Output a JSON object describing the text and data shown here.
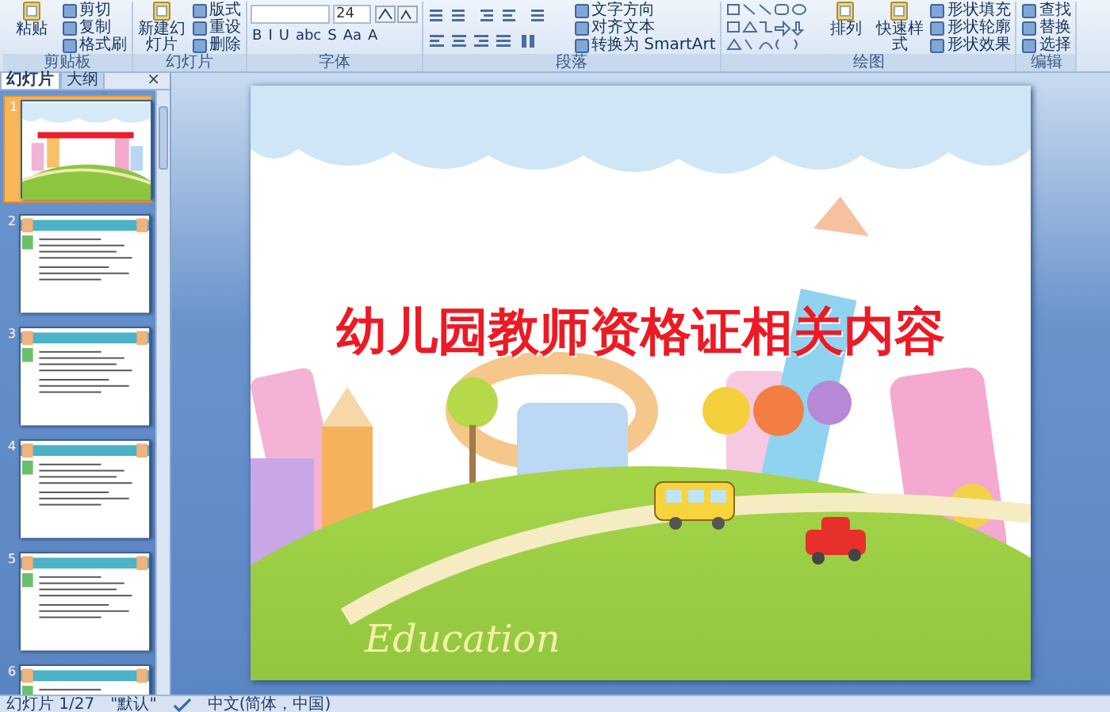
{
  "ribbon": {
    "groups": [
      {
        "label": "剪贴板",
        "items": [
          {
            "kind": "big",
            "label": "粘贴"
          },
          {
            "kind": "small",
            "label": "剪切"
          },
          {
            "kind": "small",
            "label": "复制"
          },
          {
            "kind": "small",
            "label": "格式刷"
          }
        ]
      },
      {
        "label": "幻灯片",
        "items": [
          {
            "kind": "big",
            "label": "新建幻灯片"
          },
          {
            "kind": "small",
            "label": "版式"
          },
          {
            "kind": "small",
            "label": "重设"
          },
          {
            "kind": "small",
            "label": "删除"
          }
        ]
      },
      {
        "label": "字体",
        "items": [
          {
            "kind": "field",
            "value": "24"
          },
          {
            "kind": "tool",
            "label": "B"
          },
          {
            "kind": "tool",
            "label": "I"
          },
          {
            "kind": "tool",
            "label": "U"
          },
          {
            "kind": "tool",
            "label": "abc"
          },
          {
            "kind": "tool",
            "label": "S"
          },
          {
            "kind": "tool",
            "label": "Aa"
          },
          {
            "kind": "tool",
            "label": "A"
          }
        ]
      },
      {
        "label": "段落",
        "items": [
          {
            "kind": "aligns"
          },
          {
            "kind": "small",
            "label": "文字方向"
          },
          {
            "kind": "small",
            "label": "对齐文本"
          },
          {
            "kind": "small",
            "label": "转换为 SmartArt"
          }
        ]
      },
      {
        "label": "绘图",
        "items": [
          {
            "kind": "shapes"
          },
          {
            "kind": "big",
            "label": "排列"
          },
          {
            "kind": "big",
            "label": "快速样式"
          },
          {
            "kind": "small",
            "label": "形状填充"
          },
          {
            "kind": "small",
            "label": "形状轮廓"
          },
          {
            "kind": "small",
            "label": "形状效果"
          }
        ]
      },
      {
        "label": "编辑",
        "items": [
          {
            "kind": "small",
            "label": "查找"
          },
          {
            "kind": "small",
            "label": "替换"
          },
          {
            "kind": "small",
            "label": "选择"
          }
        ]
      }
    ]
  },
  "sidebar": {
    "tabs": [
      {
        "label": "幻灯片",
        "selected": true
      },
      {
        "label": "大纲",
        "selected": false
      }
    ],
    "close": "×",
    "slides": [
      {
        "number": "1",
        "kind": "title",
        "selected": true
      },
      {
        "number": "2",
        "kind": "content",
        "selected": false
      },
      {
        "number": "3",
        "kind": "content",
        "selected": false
      },
      {
        "number": "4",
        "kind": "content",
        "selected": false
      },
      {
        "number": "5",
        "kind": "content",
        "selected": false
      },
      {
        "number": "6",
        "kind": "content",
        "selected": false
      }
    ]
  },
  "slide": {
    "title": "幼儿园教师资格证相关内容",
    "artwork_text": "Education"
  },
  "status_bar": {
    "slide_counter": "幻灯片 1/27",
    "theme": "\"默认\"",
    "language": "中文(简体，中国)"
  }
}
